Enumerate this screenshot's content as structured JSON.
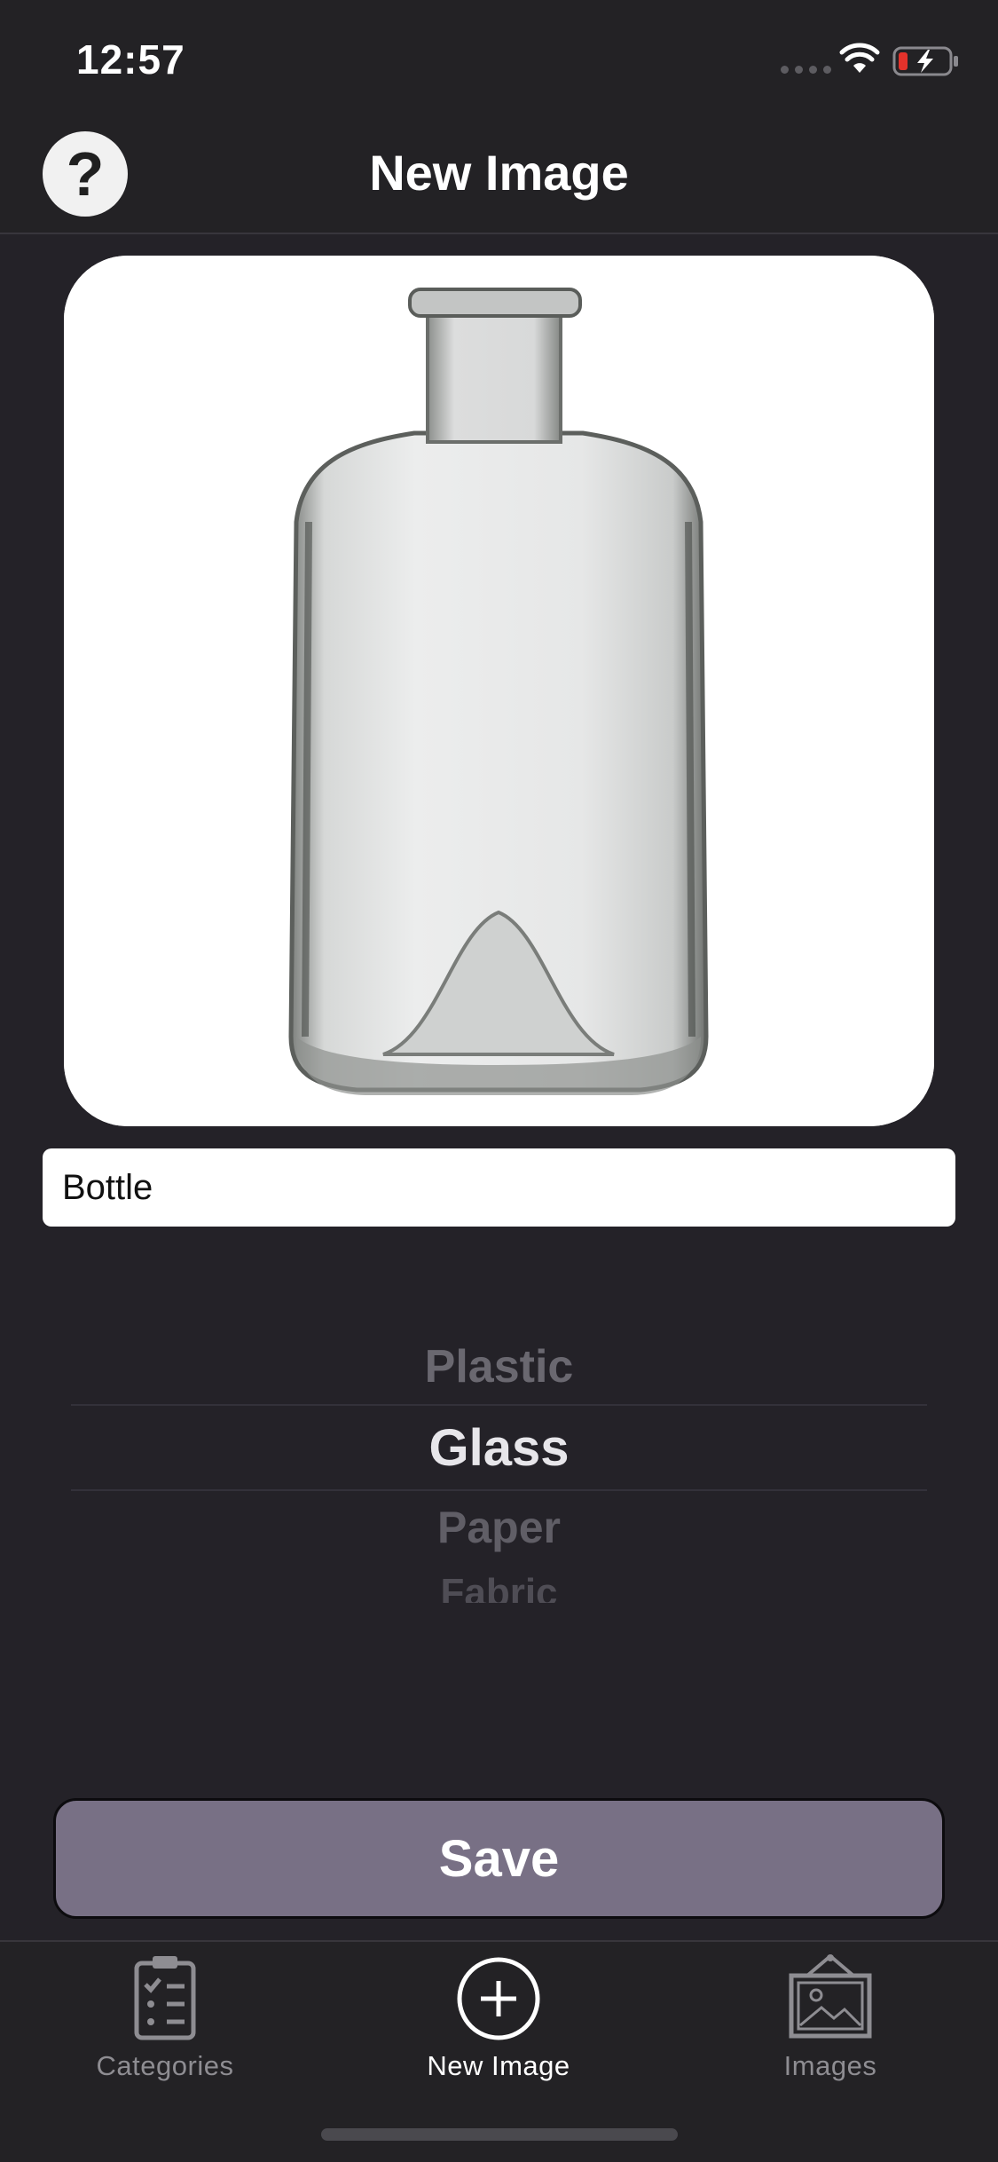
{
  "status_bar": {
    "time": "12:57"
  },
  "nav": {
    "title": "New Image",
    "help_symbol": "?"
  },
  "photo": {
    "subject": "glass-bottle-photo"
  },
  "name_input": {
    "value": "Bottle",
    "placeholder": ""
  },
  "picker": {
    "items": [
      "Plastic",
      "Glass",
      "Paper",
      "Fabric"
    ],
    "selected": "Glass"
  },
  "save_button": {
    "label": "Save"
  },
  "tab_bar": {
    "tabs": [
      {
        "label": "Categories",
        "icon": "clipboard-checklist-icon",
        "active": false
      },
      {
        "label": "New Image",
        "icon": "plus-circle-icon",
        "active": true
      },
      {
        "label": "Images",
        "icon": "framed-picture-icon",
        "active": false
      }
    ]
  },
  "colors": {
    "background": "#242228",
    "bar": "#232225",
    "save_button": "#787085",
    "battery_low": "#e3322b"
  }
}
